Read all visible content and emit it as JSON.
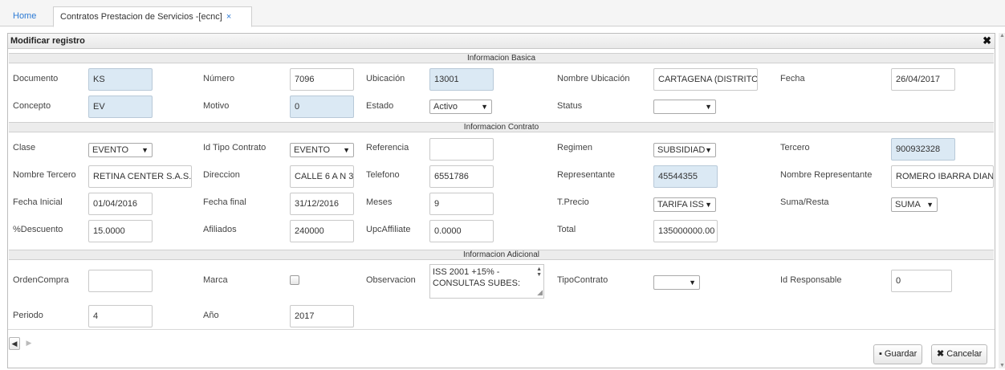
{
  "tabs": {
    "home": "Home",
    "active": "Contratos Prestacion de Servicios -[ecnc]",
    "close_glyph": "×"
  },
  "dialog": {
    "title": "Modificar registro",
    "close_glyph": "✖"
  },
  "sections": {
    "basica": "Informacion Basica",
    "contrato": "Informacion Contrato",
    "adicional": "Informacion Adicional"
  },
  "basica": {
    "documento": {
      "label": "Documento",
      "value": "KS"
    },
    "numero": {
      "label": "Número",
      "value": "7096"
    },
    "ubicacion": {
      "label": "Ubicación",
      "value": "13001"
    },
    "nombre_ubicacion": {
      "label": "Nombre Ubicación",
      "value": "CARTAGENA (DISTRITO"
    },
    "fecha": {
      "label": "Fecha",
      "value": "26/04/2017"
    },
    "concepto": {
      "label": "Concepto",
      "value": "EV"
    },
    "motivo": {
      "label": "Motivo",
      "value": "0"
    },
    "estado": {
      "label": "Estado",
      "value": "Activo"
    },
    "status": {
      "label": "Status",
      "value": ""
    }
  },
  "contrato": {
    "clase": {
      "label": "Clase",
      "value": "EVENTO"
    },
    "id_tipo_contrato": {
      "label": "Id Tipo Contrato",
      "value": "EVENTO"
    },
    "referencia": {
      "label": "Referencia",
      "value": ""
    },
    "regimen": {
      "label": "Regimen",
      "value": "SUBSIDIAD"
    },
    "tercero": {
      "label": "Tercero",
      "value": "900932328"
    },
    "nombre_tercero": {
      "label": "Nombre Tercero",
      "value": "RETINA CENTER S.A.S."
    },
    "direccion": {
      "label": "Direccion",
      "value": "CALLE 6 A N 3"
    },
    "telefono": {
      "label": "Telefono",
      "value": "6551786"
    },
    "representante": {
      "label": "Representante",
      "value": "45544355"
    },
    "nombre_representante": {
      "label": "Nombre Representante",
      "value": "ROMERO IBARRA DIANA"
    },
    "fecha_inicial": {
      "label": "Fecha Inicial",
      "value": "01/04/2016"
    },
    "fecha_final": {
      "label": "Fecha final",
      "value": "31/12/2016"
    },
    "meses": {
      "label": "Meses",
      "value": "9"
    },
    "tprecio": {
      "label": "T.Precio",
      "value": "TARIFA ISS"
    },
    "suma_resta": {
      "label": "Suma/Resta",
      "value": "SUMA"
    },
    "descuento": {
      "label": "%Descuento",
      "value": "15.0000"
    },
    "afiliados": {
      "label": "Afiliados",
      "value": "240000"
    },
    "upc": {
      "label": "UpcAffiliate",
      "value": "0.0000"
    },
    "total": {
      "label": "Total",
      "value": "135000000.00"
    }
  },
  "adicional": {
    "orden_compra": {
      "label": "OrdenCompra",
      "value": ""
    },
    "marca": {
      "label": "Marca"
    },
    "observacion": {
      "label": "Observacion",
      "line1": "ISS 2001 +15% -",
      "line2": "CONSULTAS SUBES:"
    },
    "tipo_contrato": {
      "label": "TipoContrato",
      "value": ""
    },
    "id_responsable": {
      "label": "Id Responsable",
      "value": "0"
    },
    "periodo": {
      "label": "Periodo",
      "value": "4"
    },
    "anio": {
      "label": "Año",
      "value": "2017"
    }
  },
  "buttons": {
    "guardar": "Guardar",
    "cancelar": "Cancelar",
    "guardar_icon": "save-icon",
    "cancelar_icon": "x-icon"
  },
  "pager": {
    "prev": "◀",
    "next": "▶"
  },
  "colors": {
    "accent": "#2d7bd5",
    "readonly_field": "#dbe9f4"
  }
}
